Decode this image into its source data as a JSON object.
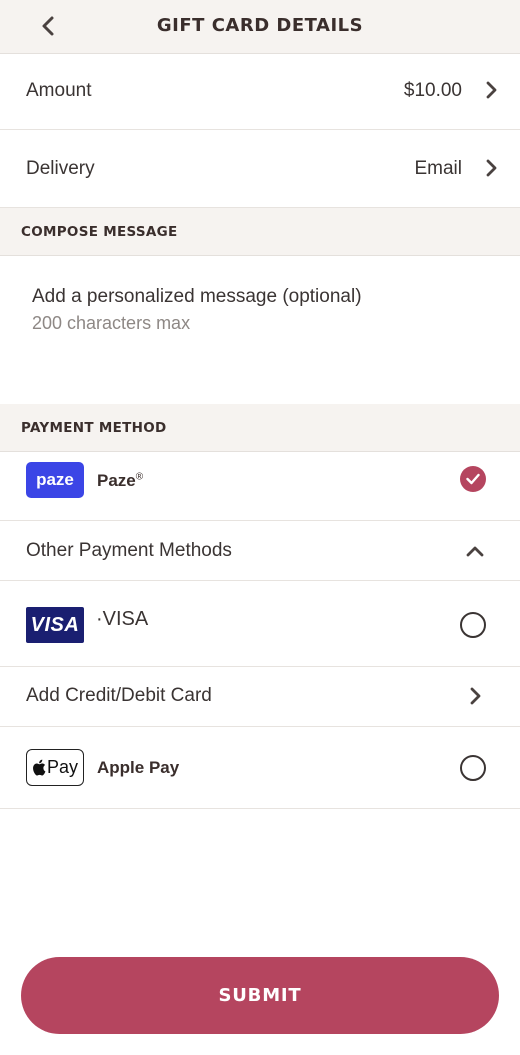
{
  "header": {
    "title": "GIFT CARD DETAILS",
    "back_icon": "chevron-left-icon"
  },
  "amount": {
    "label": "Amount",
    "value": "$10.00"
  },
  "delivery": {
    "label": "Delivery",
    "value": "Email"
  },
  "compose": {
    "section_title": "COMPOSE MESSAGE",
    "placeholder": "Add a personalized message (optional)",
    "hint": "200 characters max"
  },
  "payment": {
    "section_title": "PAYMENT METHOD",
    "paze": {
      "logo_text": "paze",
      "name": "Paze",
      "mark": "®",
      "selected": true
    },
    "other_methods_label": "Other Payment Methods",
    "visa": {
      "logo_text": "VISA",
      "name": "·VISA",
      "selected": false
    },
    "add_card_label": "Add Credit/Debit Card",
    "apple_pay": {
      "logo_text": "Pay",
      "name": "Apple Pay",
      "selected": false
    }
  },
  "submit_label": "SUBMIT",
  "colors": {
    "accent": "#b5455f",
    "paze_blue": "#3b45e6",
    "visa_navy": "#1a1f71",
    "section_bg": "#f6f3f0"
  }
}
